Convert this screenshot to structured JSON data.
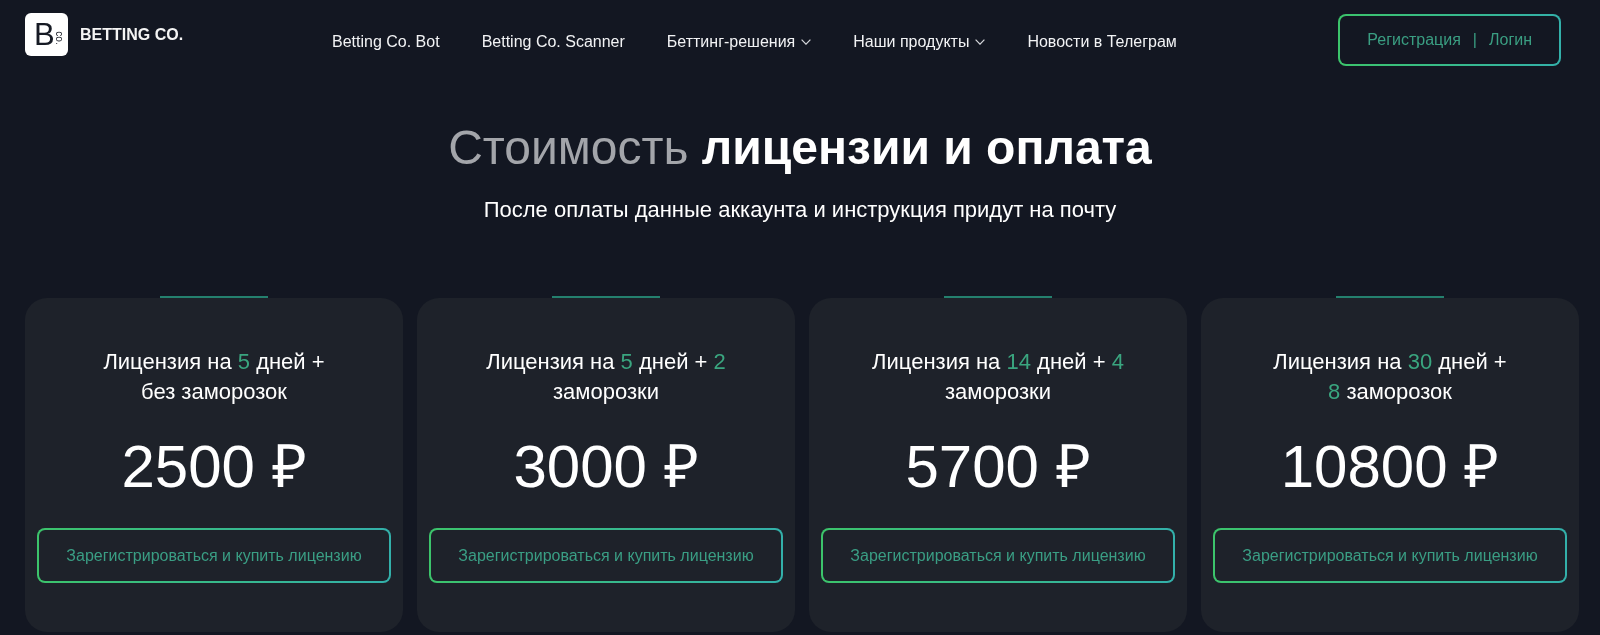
{
  "header": {
    "logo": {
      "mark": "B",
      "mark_small": "co.",
      "name": "BETTING CO."
    },
    "nav": [
      {
        "label": "Betting Co. Bot",
        "kind": "link"
      },
      {
        "label": "Betting Co. Scanner",
        "kind": "link"
      },
      {
        "label": "Беттинг-решения",
        "kind": "dropdown"
      },
      {
        "label": "Наши продукты",
        "kind": "dropdown"
      },
      {
        "label": "Новости в Телеграм",
        "kind": "link"
      }
    ],
    "auth": {
      "register": "Регистрация",
      "separator": "|",
      "login": "Логин"
    }
  },
  "pricing": {
    "heading": "Стоимость **лицензии и оплата**",
    "subtitle": "После оплаты данные аккаунта и инструкция придут на почту",
    "plans": [
      {
        "title_lines": [
          [
            {
              "text": "Лицензия на ",
              "accent": false
            },
            {
              "text": "5",
              "accent": true
            },
            {
              "text": " дней +",
              "accent": false
            }
          ],
          [
            {
              "text": "без заморозок",
              "accent": false
            }
          ]
        ],
        "price": "2500 ₽",
        "button": "Зарегистрироваться и купить лицензию"
      },
      {
        "title_lines": [
          [
            {
              "text": "Лицензия на ",
              "accent": false
            },
            {
              "text": "5",
              "accent": true
            },
            {
              "text": " дней + ",
              "accent": false
            },
            {
              "text": "2",
              "accent": true
            }
          ],
          [
            {
              "text": "заморозки",
              "accent": false
            }
          ]
        ],
        "price": "3000 ₽",
        "button": "Зарегистрироваться и купить лицензию"
      },
      {
        "title_lines": [
          [
            {
              "text": "Лицензия на ",
              "accent": false
            },
            {
              "text": "14",
              "accent": true
            },
            {
              "text": " дней + ",
              "accent": false
            },
            {
              "text": "4",
              "accent": true
            }
          ],
          [
            {
              "text": "заморозки",
              "accent": false
            }
          ]
        ],
        "price": "5700 ₽",
        "button": "Зарегистрироваться и купить лицензию"
      },
      {
        "title_lines": [
          [
            {
              "text": "Лицензия на ",
              "accent": false
            },
            {
              "text": "30",
              "accent": true
            },
            {
              "text": " дней +",
              "accent": false
            }
          ],
          [
            {
              "text": "8",
              "accent": true
            },
            {
              "text": " заморозок",
              "accent": false
            }
          ]
        ],
        "price": "10800 ₽",
        "button": "Зарегистрироваться и купить лицензию"
      }
    ]
  }
}
